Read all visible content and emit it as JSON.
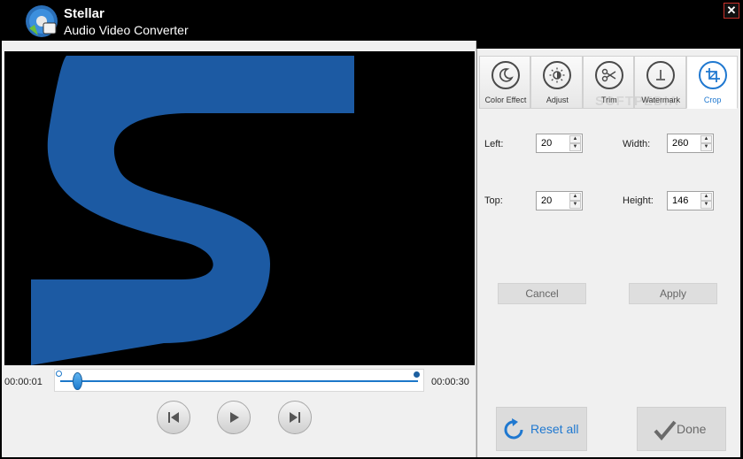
{
  "app": {
    "title_line1": "Stellar",
    "title_line2": "Audio Video Converter",
    "close_label": "✕"
  },
  "player": {
    "time_start": "00:00:01",
    "time_end": "00:00:30",
    "seek_position_seconds": 1,
    "duration_seconds": 30,
    "controls": [
      "previous",
      "play",
      "next"
    ]
  },
  "tabs": [
    {
      "label": "Color Effect",
      "icon": "color-effect-icon",
      "active": false
    },
    {
      "label": "Adjust",
      "icon": "adjust-icon",
      "active": false
    },
    {
      "label": "Trim",
      "icon": "scissors-icon",
      "active": false
    },
    {
      "label": "Watermark",
      "icon": "watermark-icon",
      "active": false
    },
    {
      "label": "Crop",
      "icon": "crop-icon",
      "active": true
    }
  ],
  "crop": {
    "left_label": "Left:",
    "left_value": "20",
    "width_label": "Width:",
    "width_value": "260",
    "top_label": "Top:",
    "top_value": "20",
    "height_label": "Height:",
    "height_value": "146",
    "cancel_label": "Cancel",
    "apply_label": "Apply"
  },
  "footer": {
    "reset_label": "Reset all",
    "done_label": "Done"
  },
  "watermark_text": "SOFTPEDIA",
  "colors": {
    "accent": "#1f78d0",
    "video_logo": "#1c5aa3",
    "close_border": "#c8302a"
  }
}
